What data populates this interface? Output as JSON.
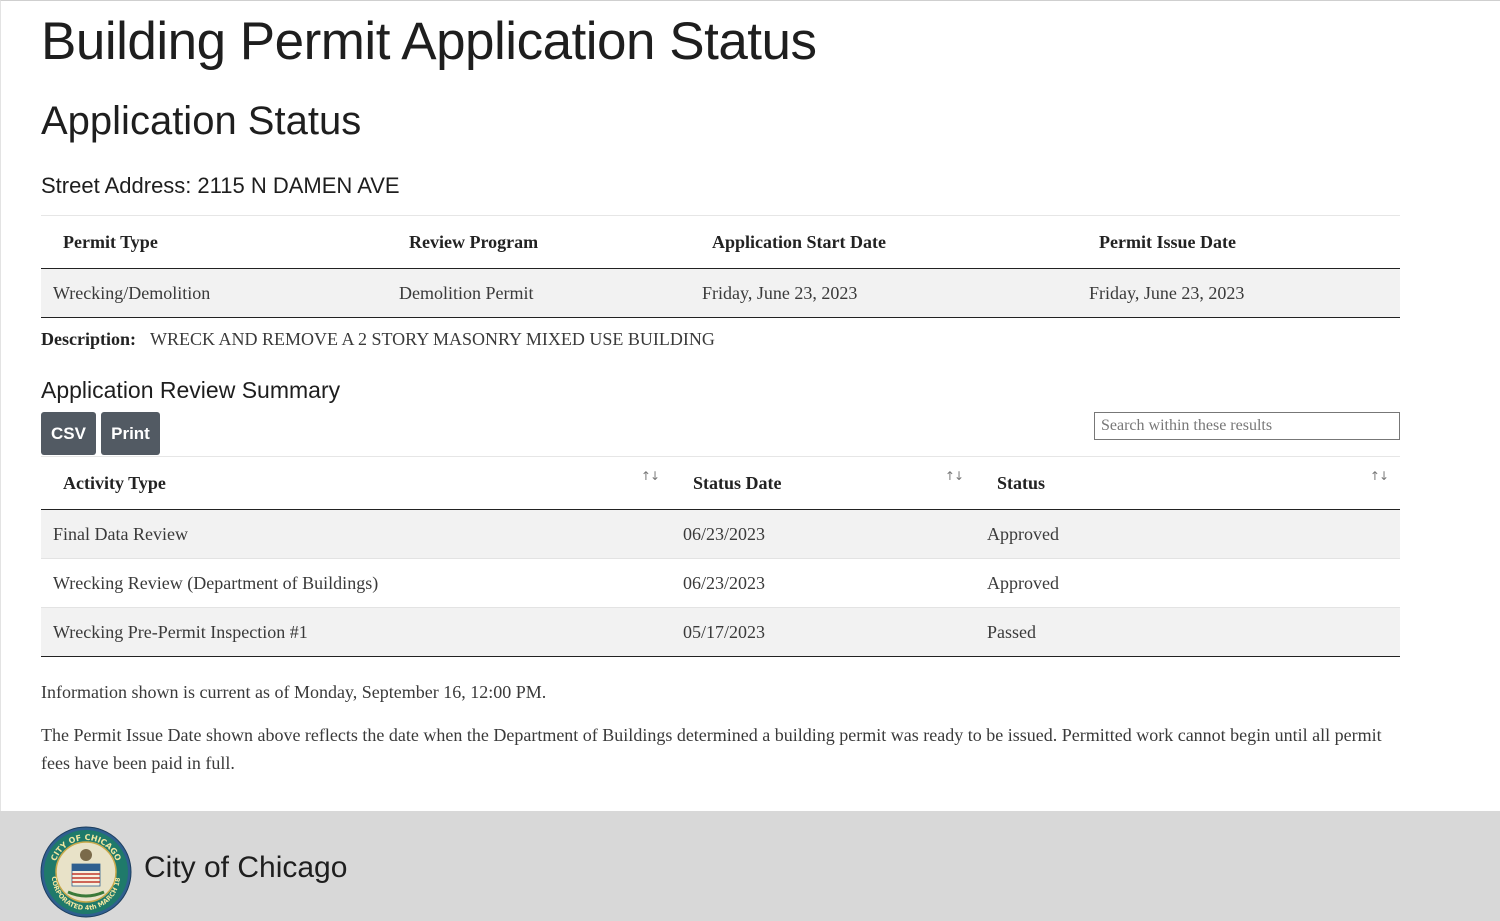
{
  "page": {
    "title": "Building Permit Application Status",
    "subtitle": "Application Status",
    "address_label": "Street Address:",
    "address_value": "2115 N DAMEN AVE"
  },
  "permit_table": {
    "headers": [
      "Permit Type",
      "Review Program",
      "Application Start Date",
      "Permit Issue Date"
    ],
    "row": [
      "Wrecking/Demolition",
      "Demolition Permit",
      "Friday, June 23, 2023",
      "Friday, June 23, 2023"
    ]
  },
  "description": {
    "label": "Description:",
    "value": "WRECK AND REMOVE A 2 STORY MASONRY MIXED USE BUILDING"
  },
  "review_summary": {
    "title": "Application Review Summary",
    "csv_label": "CSV",
    "print_label": "Print",
    "search_placeholder": "Search within these results",
    "sort_icon": "sort-arrows-icon",
    "headers": [
      "Activity Type",
      "Status Date",
      "Status"
    ],
    "rows": [
      [
        "Final Data Review",
        "06/23/2023",
        "Approved"
      ],
      [
        "Wrecking Review (Department of Buildings)",
        "06/23/2023",
        "Approved"
      ],
      [
        "Wrecking Pre-Permit Inspection #1",
        "05/17/2023",
        "Passed"
      ]
    ]
  },
  "notes": {
    "current_as_of": "Information shown is current as of Monday, September 16, 12:00 PM.",
    "issue_date_note": "The Permit Issue Date shown above reflects the date when the Department of Buildings determined a building permit was ready to be issued. Permitted work cannot begin until all permit fees have been paid in full."
  },
  "footer": {
    "org_name": "City of Chicago",
    "seal_text_top": "CITY OF CHICAGO",
    "seal_text_bottom": "INCORPORATED 4th MARCH 1837"
  },
  "colors": {
    "button_bg": "#525a63",
    "footer_bg": "#d8d8d8",
    "row_stripe": "#f2f2f2"
  }
}
